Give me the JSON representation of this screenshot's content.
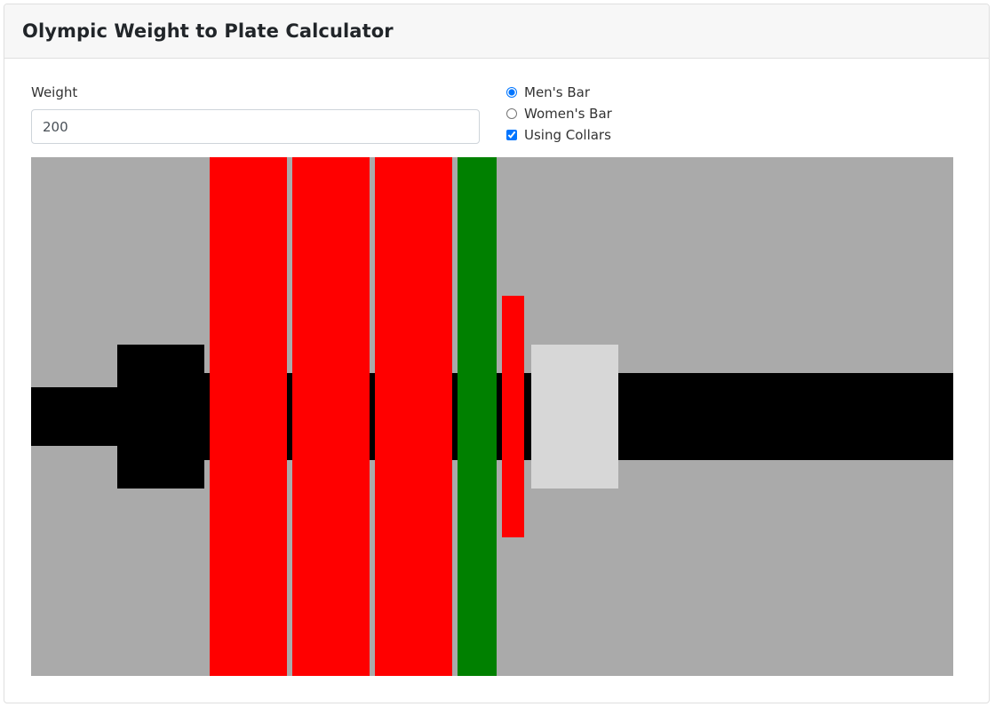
{
  "header": {
    "title": "Olympic Weight to Plate Calculator"
  },
  "form": {
    "weight_label": "Weight",
    "weight_value": "200",
    "options": {
      "mens_bar": {
        "label": "Men's Bar",
        "checked": true
      },
      "womens_bar": {
        "label": "Women's Bar",
        "checked": false
      },
      "collars": {
        "label": "Using Collars",
        "checked": true
      }
    }
  },
  "visual": {
    "background_color": "#aaaaaa",
    "bar_color": "#000000",
    "collar_color": "#d7d7d7",
    "plates": [
      {
        "color": "#ff0000",
        "size": "large"
      },
      {
        "color": "#ff0000",
        "size": "large"
      },
      {
        "color": "#ff0000",
        "size": "large"
      },
      {
        "color": "#008000",
        "size": "large"
      },
      {
        "color": "#ff0000",
        "size": "small"
      }
    ]
  }
}
